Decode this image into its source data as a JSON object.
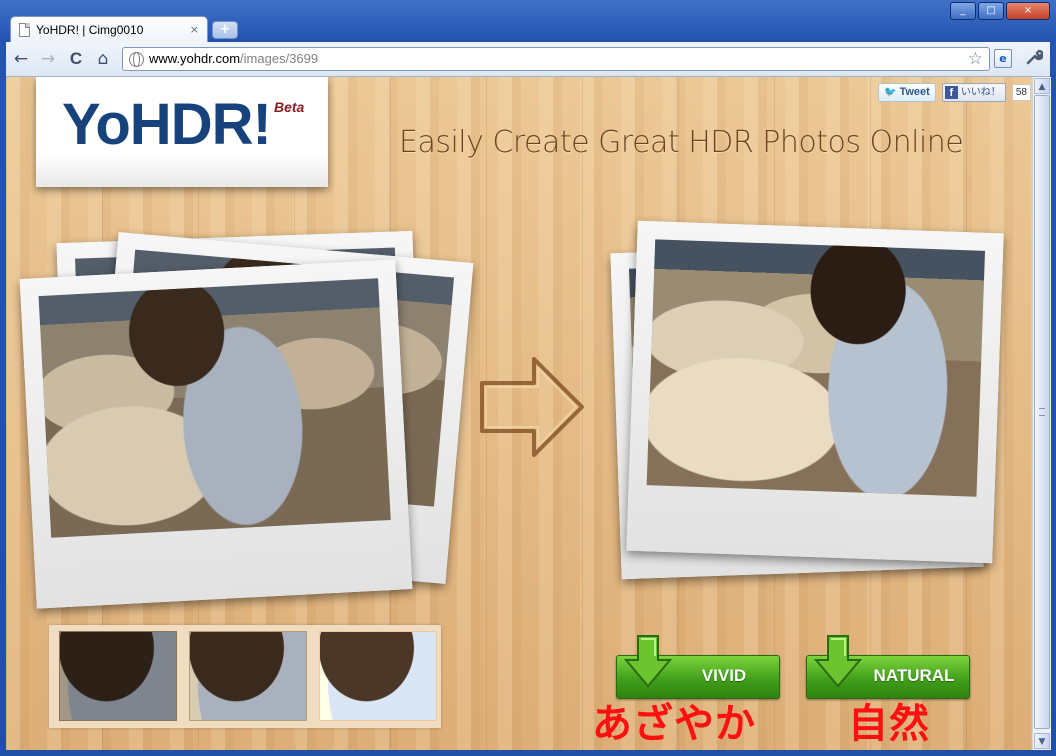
{
  "browser": {
    "tab_title": "YoHDR! | Cimg0010",
    "tab_close": "×",
    "new_tab": "+",
    "url_host": "www.yohdr.com",
    "url_path": "/images/3699",
    "nav": {
      "back": "←",
      "forward": "→",
      "reload": "C",
      "home": "⌂"
    },
    "window_controls": {
      "minimize": "_",
      "maximize": "□",
      "close": "×"
    },
    "star": "☆",
    "page_icon": "e",
    "wrench": "🔧"
  },
  "header": {
    "logo": "YoHDR!",
    "logo_beta": "Beta",
    "tagline": "Easily Create Great HDR Photos Online"
  },
  "social": {
    "tweet_label": "Tweet",
    "like_label": "いいね！",
    "like_count": "58"
  },
  "actions": {
    "vivid_label": "VIVID",
    "natural_label": "NATURAL",
    "vivid_caption": "あざやか",
    "natural_caption": "自然"
  },
  "scrollbar": {
    "up": "▲",
    "down": "▼"
  },
  "icons": {
    "tab": "page-icon",
    "globe": "globe-icon",
    "star": "star-icon",
    "wrench": "wrench-icon",
    "twitter": "twitter-bird-icon",
    "facebook": "facebook-icon",
    "download": "download-arrow-icon",
    "arrow": "right-arrow-icon"
  },
  "colors": {
    "logo": "#17427c",
    "tagline": "#6b4520",
    "button_green": "#41a01a",
    "caption_red": "#ff1010",
    "wood": "#e2b782"
  }
}
